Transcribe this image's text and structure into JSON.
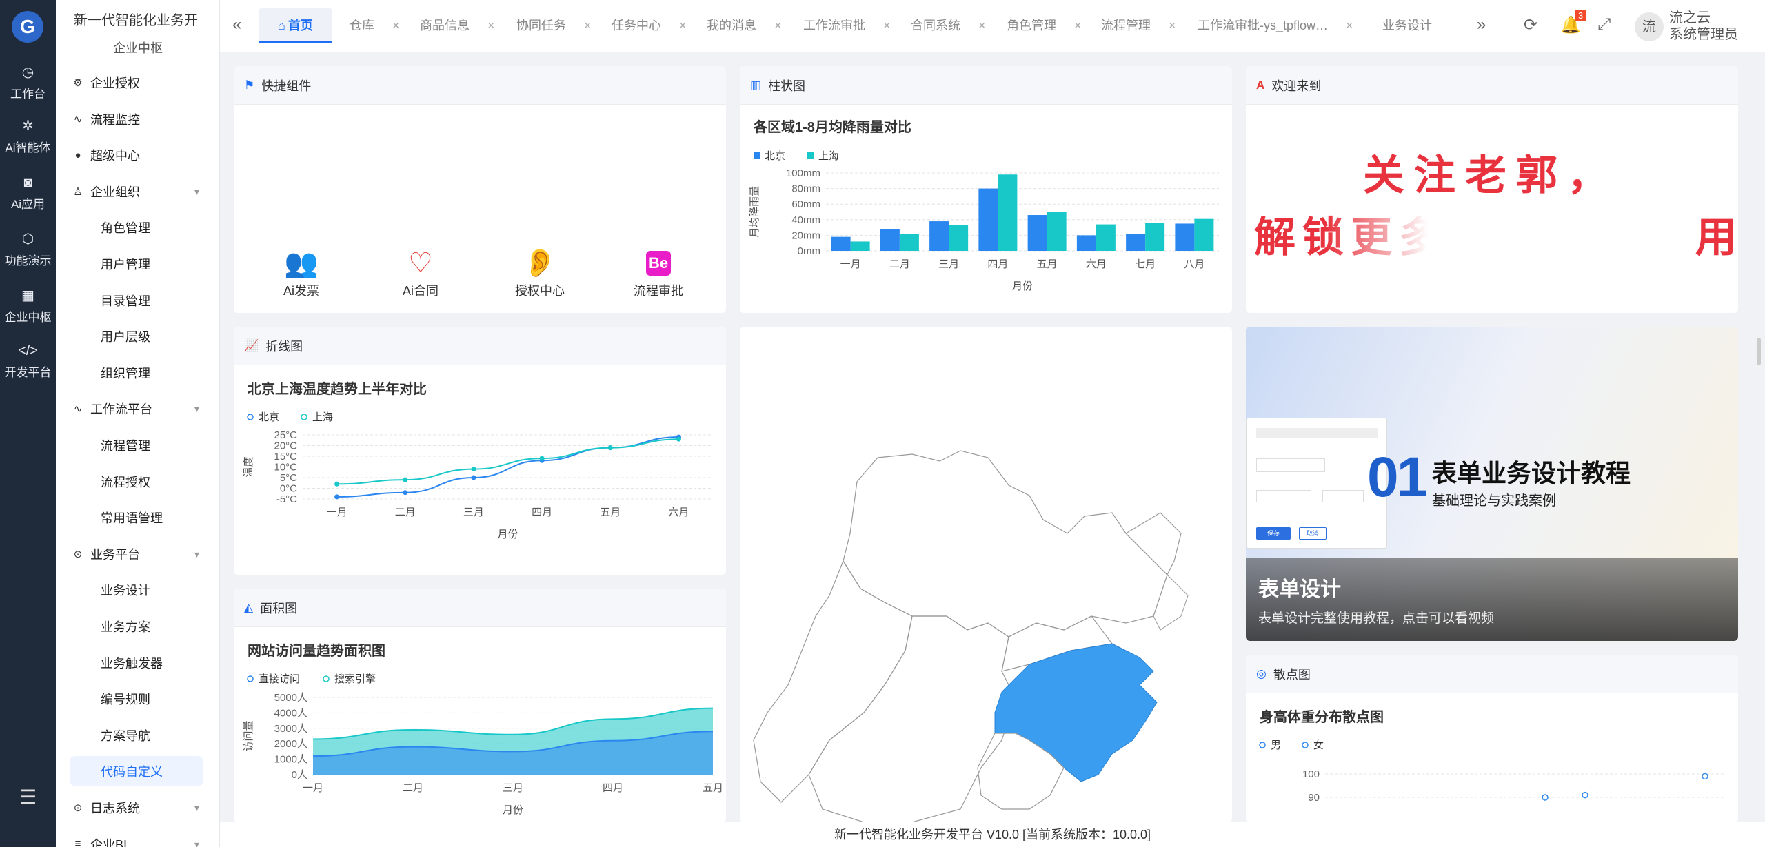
{
  "rail": {
    "logo": "G",
    "items": [
      {
        "icon": "dashboard-icon",
        "glyph": "◷",
        "label": "工作台"
      },
      {
        "icon": "ai-agent-icon",
        "glyph": "✲",
        "label": "Ai智能体"
      },
      {
        "icon": "ai-app-icon",
        "glyph": "◙",
        "label": "Ai应用"
      },
      {
        "icon": "cube-icon",
        "glyph": "⬡",
        "label": "功能演示"
      },
      {
        "icon": "grid-icon",
        "glyph": "▦",
        "label": "企业中枢"
      },
      {
        "icon": "code-icon",
        "glyph": "</>",
        "label": "开发平台"
      }
    ]
  },
  "menu": {
    "title": "新一代智能化业务开",
    "subtitle": "企业中枢",
    "items": [
      {
        "icon": "⚙",
        "label": "企业授权",
        "type": "top"
      },
      {
        "icon": "∿",
        "label": "流程监控",
        "type": "top"
      },
      {
        "icon": "●",
        "label": "超级中心",
        "type": "top"
      },
      {
        "icon": "♙",
        "label": "企业组织",
        "type": "group"
      },
      {
        "label": "角色管理",
        "type": "sub"
      },
      {
        "label": "用户管理",
        "type": "sub"
      },
      {
        "label": "目录管理",
        "type": "sub"
      },
      {
        "label": "用户层级",
        "type": "sub"
      },
      {
        "label": "组织管理",
        "type": "sub"
      },
      {
        "icon": "∿",
        "label": "工作流平台",
        "type": "group"
      },
      {
        "label": "流程管理",
        "type": "sub"
      },
      {
        "label": "流程授权",
        "type": "sub"
      },
      {
        "label": "常用语管理",
        "type": "sub"
      },
      {
        "icon": "⊙",
        "label": "业务平台",
        "type": "group"
      },
      {
        "label": "业务设计",
        "type": "sub"
      },
      {
        "label": "业务方案",
        "type": "sub"
      },
      {
        "label": "业务触发器",
        "type": "sub"
      },
      {
        "label": "编号规则",
        "type": "sub"
      },
      {
        "label": "方案导航",
        "type": "sub"
      },
      {
        "label": "代码自定义",
        "type": "active"
      },
      {
        "icon": "⊙",
        "label": "日志系统",
        "type": "group"
      },
      {
        "icon": "≡",
        "label": "企业BI",
        "type": "group"
      }
    ]
  },
  "tabs": [
    "首页",
    "仓库",
    "商品信息",
    "协同任务",
    "任务中心",
    "我的消息",
    "工作流审批",
    "合同系统",
    "角色管理",
    "流程管理",
    "工作流审批-ys_tpflow…",
    "业务设计"
  ],
  "header": {
    "notif_count": "3",
    "avatar_char": "流",
    "user_name": "流之云",
    "user_role": "系统管理员"
  },
  "quick": {
    "title": "快捷组件",
    "items": [
      {
        "label": "Ai发票",
        "icon": "users-icon",
        "glyph": "👥",
        "color": "#3a7bd5"
      },
      {
        "label": "Ai合同",
        "icon": "heart-icon",
        "glyph": "♡",
        "color": "#e53935"
      },
      {
        "label": "授权中心",
        "icon": "hearing-icon",
        "glyph": "👂",
        "color": "#1e88e5"
      },
      {
        "label": "流程审批",
        "icon": "behance-icon",
        "glyph": "Be",
        "color": "#e91ec8"
      }
    ]
  },
  "bar_card": {
    "title": "柱状图"
  },
  "welcome": {
    "title": "欢迎来到",
    "line1": "关注老郭，",
    "line2": "解锁更多企",
    "line2_end": "用"
  },
  "line_card": {
    "title": "折线图"
  },
  "area_card": {
    "title": "面积图"
  },
  "course": {
    "num": "01",
    "title": "表单业务设计教程",
    "sub": "基础理论与实践案例",
    "caption_title": "表单设计",
    "caption_desc": "表单设计完整使用教程，点击可以看视频",
    "mock_btn1": "保存",
    "mock_btn2": "取消"
  },
  "scatter_card": {
    "title": "散点图"
  },
  "footer": "新一代智能化业务开发平台 V10.0 [当前系统版本：10.0.0]",
  "chart_data": [
    {
      "type": "bar",
      "title": "各区域1-8月均降雨量对比",
      "xlabel": "月份",
      "ylabel": "月均降雨量",
      "categories": [
        "一月",
        "二月",
        "三月",
        "四月",
        "五月",
        "六月",
        "七月",
        "八月"
      ],
      "yticks": [
        "0mm",
        "20mm",
        "40mm",
        "60mm",
        "80mm",
        "100mm"
      ],
      "ylim": [
        0,
        100
      ],
      "series": [
        {
          "name": "北京",
          "color": "#2b87f0",
          "values": [
            18,
            28,
            38,
            80,
            46,
            20,
            22,
            35
          ]
        },
        {
          "name": "上海",
          "color": "#18c7c7",
          "values": [
            12,
            22,
            33,
            98,
            50,
            34,
            36,
            41
          ]
        }
      ]
    },
    {
      "type": "line",
      "title": "北京上海温度趋势上半年对比",
      "xlabel": "月份",
      "ylabel": "温度",
      "categories": [
        "一月",
        "二月",
        "三月",
        "四月",
        "五月",
        "六月"
      ],
      "yticks": [
        "-5°C",
        "0°C",
        "5°C",
        "10°C",
        "15°C",
        "20°C",
        "25°C"
      ],
      "ylim": [
        -5,
        25
      ],
      "series": [
        {
          "name": "北京",
          "color": "#2b87f0",
          "values": [
            -4,
            -2,
            5,
            13,
            19,
            24
          ]
        },
        {
          "name": "上海",
          "color": "#18c7c7",
          "values": [
            2,
            4,
            9,
            14,
            19,
            23
          ]
        }
      ]
    },
    {
      "type": "area",
      "title": "网站访问量趋势面积图",
      "xlabel": "月份",
      "ylabel": "访问量",
      "categories": [
        "一月",
        "二月",
        "三月",
        "四月",
        "五月"
      ],
      "yticks": [
        "0人",
        "1000人",
        "2000人",
        "3000人",
        "4000人",
        "5000人"
      ],
      "ylim": [
        0,
        5000
      ],
      "series": [
        {
          "name": "直接访问",
          "color": "#2b87f0",
          "values": [
            1200,
            1800,
            1500,
            2200,
            2800
          ]
        },
        {
          "name": "搜索引擎",
          "color": "#18c7c7",
          "values": [
            2300,
            2900,
            2600,
            3600,
            4300
          ]
        }
      ]
    },
    {
      "type": "scatter",
      "title": "身高体重分布散点图",
      "ylabel": "",
      "yticks": [
        "90",
        "100"
      ],
      "ylim": [
        85,
        105
      ],
      "series": [
        {
          "name": "男",
          "color": "#2b87f0",
          "points": [
            [
              0.95,
              99
            ]
          ]
        },
        {
          "name": "女",
          "color": "#2b87f0",
          "points": [
            [
              0.55,
              90
            ],
            [
              0.65,
              91
            ]
          ]
        }
      ]
    }
  ]
}
